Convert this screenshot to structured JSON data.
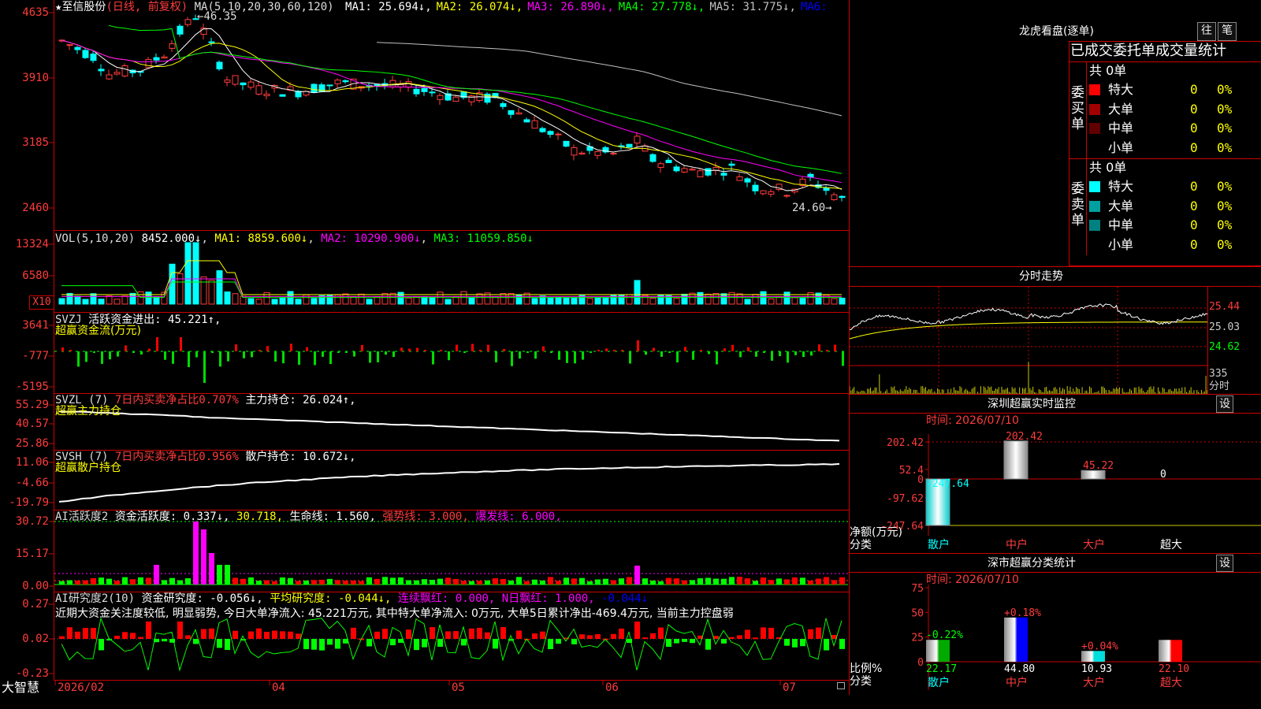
{
  "main": {
    "stock_name": "至信股份",
    "mode": "(日线, 前复权)",
    "ma_title": "MA(5,10,20,30,60,120)",
    "ma_values": [
      {
        "label": "MA1:",
        "value": "25.694↓",
        "color": "#ffffff"
      },
      {
        "label": "MA2:",
        "value": "26.074↓",
        "color": "#ffff00"
      },
      {
        "label": "MA3:",
        "value": "26.890↓",
        "color": "#ff00ff"
      },
      {
        "label": "MA4:",
        "value": "27.778↓",
        "color": "#00ff00"
      },
      {
        "label": "MA5:",
        "value": "31.775↓",
        "color": "#c0c0c0"
      },
      {
        "label": "MA6:",
        "value": "",
        "color": "#0000ff"
      }
    ],
    "high_label": "46.35",
    "low_label": "24.60",
    "y_ticks": [
      "4635",
      "3910",
      "3185",
      "2460"
    ]
  },
  "vol": {
    "title": "VOL(5,10,20)",
    "value": "8452.000↓",
    "ma1": "MA1: 8859.600↓",
    "ma2": "MA2: 10290.900↓",
    "ma3": "MA3: 11059.850↓",
    "y_ticks": [
      "13324",
      "6580"
    ],
    "unit": "X10"
  },
  "svzj": {
    "title": "SVZJ",
    "label": "活跃资金进出: 45.221↑,",
    "subtitle": "超赢资金流(万元)",
    "y_ticks": [
      "3641",
      "-777",
      "-5195"
    ]
  },
  "svzl": {
    "title": "SVZL (7)",
    "ratio": "7日内买卖净占比0.707%",
    "hold": "主力持仓: 26.024↑,",
    "subtitle": "超赢主力持仓",
    "y_ticks": [
      "55.29",
      "40.57",
      "25.86"
    ]
  },
  "svsh": {
    "title": "SVSH (7)",
    "ratio": "7日内买卖净占比0.956%",
    "hold": "散户持仓: 10.672↓,",
    "subtitle": "超赢散户持仓",
    "y_ticks": [
      "11.06",
      "-4.66",
      "-19.79"
    ]
  },
  "ai1": {
    "title": "AI活跃度2",
    "v1": "资金活跃度: 0.337↓,",
    "v2": "30.718,",
    "v3": "生命线: 1.560,",
    "v4": "强势线: 3.000,",
    "v5": "爆发线: 6.000,",
    "y_ticks": [
      "30.72",
      "15.17",
      "0.00"
    ]
  },
  "ai2": {
    "title": "AI研究度2(10)",
    "v1": "资金研究度: -0.056↓,",
    "v2": "平均研究度: -0.044↓,",
    "v3": "连续飘红: 0.000,",
    "v4": "N日飘红: 1.000,",
    "v5": "-0.044↓",
    "commentary": "近期大资金关注度较低, 明显弱势, 今日大单净流入: 45.221万元, 其中特大单净流入: 0万元, 大单5日累计净出-469.4万元, 当前主力控盘弱",
    "y_ticks": [
      "0.27",
      "0.02",
      "-0.23"
    ]
  },
  "bottom": {
    "brand": "大智慧",
    "dates": [
      "2026/02",
      "04",
      "05",
      "06",
      "07"
    ]
  },
  "right": {
    "lhb_title": "龙虎看盘(逐单)",
    "tab_wang": "往",
    "tab_bi": "笔",
    "stats_title": "已成交委托单成交量统计",
    "buy_label": "委买单",
    "sell_label": "委卖单",
    "buy_total": "共 0单",
    "sell_total": "共 0单",
    "buy_rows": [
      {
        "name": "特大",
        "count": "0",
        "pct": "0%",
        "color": "#ff0000"
      },
      {
        "name": "大单",
        "count": "0",
        "pct": "0%",
        "color": "#a00000"
      },
      {
        "name": "中单",
        "count": "0",
        "pct": "0%",
        "color": "#600000"
      },
      {
        "name": "小单",
        "count": "0",
        "pct": "0%",
        "color": ""
      }
    ],
    "sell_rows": [
      {
        "name": "特大",
        "count": "0",
        "pct": "0%",
        "color": "#00ffff"
      },
      {
        "name": "大单",
        "count": "0",
        "pct": "0%",
        "color": "#00a0a0"
      },
      {
        "name": "中单",
        "count": "0",
        "pct": "0%",
        "color": "#008080"
      },
      {
        "name": "小单",
        "count": "0",
        "pct": "0%",
        "color": ""
      }
    ],
    "intraday_title": "分时走势",
    "intraday_y": [
      "25.44",
      "25.03",
      "24.62"
    ],
    "intraday_vol": "335",
    "intraday_label": "分时",
    "monitor_title": "深圳超赢实时监控",
    "monitor_btn": "设",
    "monitor_time": "时间: 2026/07/10",
    "monitor_y": [
      "202.42",
      "52.4",
      "0",
      "-97.62",
      "-247.64"
    ],
    "monitor_axis_label": "净额(万元)",
    "monitor_cat_label": "分类",
    "stat_title": "深市超赢分类统计",
    "stat_btn": "设",
    "stat_time": "时间: 2026/07/10",
    "stat_y": [
      "75",
      "50",
      "25",
      "0"
    ],
    "stat_axis_label": "比例%",
    "stat_cat_label": "分类"
  },
  "chart_data": [
    {
      "type": "bar",
      "title": "深圳超赢实时监控",
      "categories": [
        "散户",
        "中户",
        "大户",
        "超大"
      ],
      "values": [
        -247.64,
        202.42,
        45.22,
        0
      ],
      "ylabel": "净额(万元)",
      "ylim": [
        -247.64,
        202.42
      ],
      "labels": [
        "-247.64",
        "202.42",
        "45.22",
        "0"
      ]
    },
    {
      "type": "bar",
      "title": "深市超赢分类统计",
      "categories": [
        "散户",
        "中户",
        "大户",
        "超大"
      ],
      "values": [
        22.17,
        44.8,
        10.93,
        22.1
      ],
      "change_labels": [
        "-0.22%",
        "+0.18%",
        "+0.04%",
        ""
      ],
      "ylabel": "比例%",
      "ylim": [
        0,
        75
      ]
    }
  ]
}
